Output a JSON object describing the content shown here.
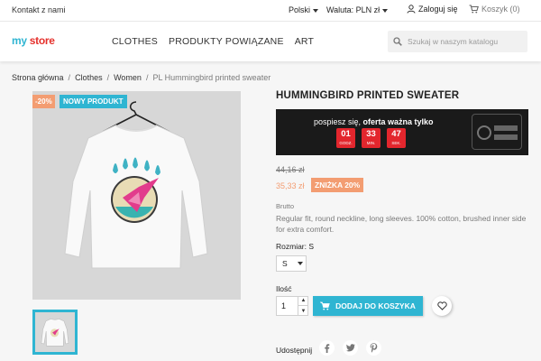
{
  "topbar": {
    "contact": "Kontakt z nami",
    "language": "Polski",
    "currency": "Waluta: PLN zł",
    "login": "Zaloguj się",
    "cart": "Koszyk (0)"
  },
  "header": {
    "logo_my": "my",
    "logo_store": "store",
    "nav": [
      "CLOTHES",
      "PRODUKTY POWIĄZANE",
      "ART"
    ],
    "search_placeholder": "Szukaj w naszym katalogu"
  },
  "breadcrumb": [
    "Strona główna",
    "Clothes",
    "Women",
    "PL Hummingbird printed sweater"
  ],
  "product": {
    "flag_discount": "-20%",
    "flag_new": "NOWY PRODUKT",
    "title": "HUMMINGBIRD PRINTED SWEATER",
    "promo_text_normal": "pospiesz się, ",
    "promo_text_bold": "oferta ważna tylko",
    "countdown": [
      {
        "value": "01",
        "label": "GODZ."
      },
      {
        "value": "33",
        "label": "MIN."
      },
      {
        "value": "47",
        "label": "SEK."
      }
    ],
    "old_price": "44,16 zł",
    "new_price": "35,33 zł",
    "discount_badge": "ZNIŻKA 20%",
    "tax_label": "Brutto",
    "description": "Regular fit, round neckline, long sleeves. 100% cotton, brushed inner side for extra comfort.",
    "size_label": "Rozmiar: S",
    "size_value": "S",
    "qty_label": "Ilość",
    "qty_value": "1",
    "add_to_cart": "DODAJ DO KOSZYKA",
    "share_label": "Udostępnij"
  },
  "colors": {
    "accent": "#2fb5d2",
    "discount": "#f39d72",
    "promo_bg": "#1a1a1a",
    "countdown_red": "#e3262d"
  },
  "icons": [
    "caret-down-icon",
    "user-icon",
    "cart-icon",
    "search-icon",
    "heart-icon",
    "facebook-icon",
    "twitter-icon",
    "pinterest-icon",
    "black-friday-badge"
  ]
}
